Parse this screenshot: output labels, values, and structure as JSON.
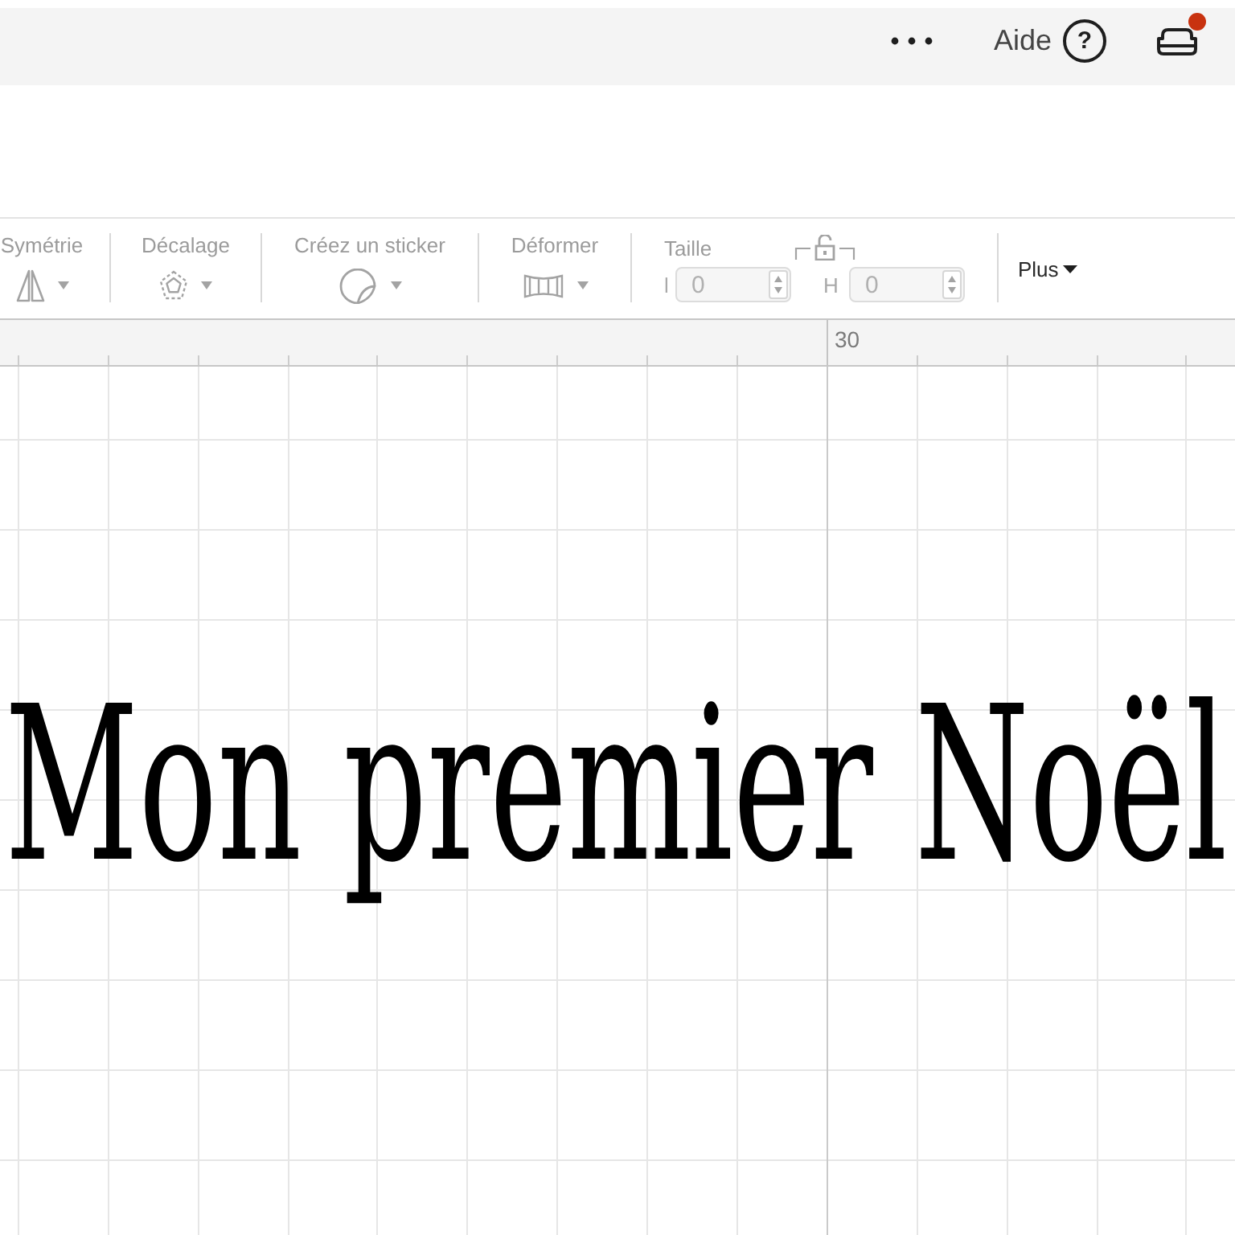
{
  "topbar": {
    "help": {
      "label": "Aide",
      "symbol": "?"
    },
    "device": {
      "notification": true
    }
  },
  "toolbar": {
    "tools": [
      {
        "kind": "mirror",
        "label": "Symétrie",
        "disabled": true
      },
      {
        "kind": "offset",
        "label": "Décalage",
        "disabled": true
      },
      {
        "kind": "sticker",
        "label": "Créez un sticker",
        "disabled": true
      },
      {
        "kind": "warp",
        "label": "Déformer",
        "disabled": true
      },
      {
        "kind": "size",
        "label": "Taille",
        "disabled": true,
        "locked": false,
        "fields": [
          {
            "label": "l",
            "value": "0"
          },
          {
            "label": "H",
            "value": "0"
          }
        ]
      }
    ],
    "more": {
      "label": "Plus",
      "disabled": false
    }
  },
  "ruler": {
    "label": "30"
  },
  "canvas": {
    "text": "Mon premier Noël"
  }
}
